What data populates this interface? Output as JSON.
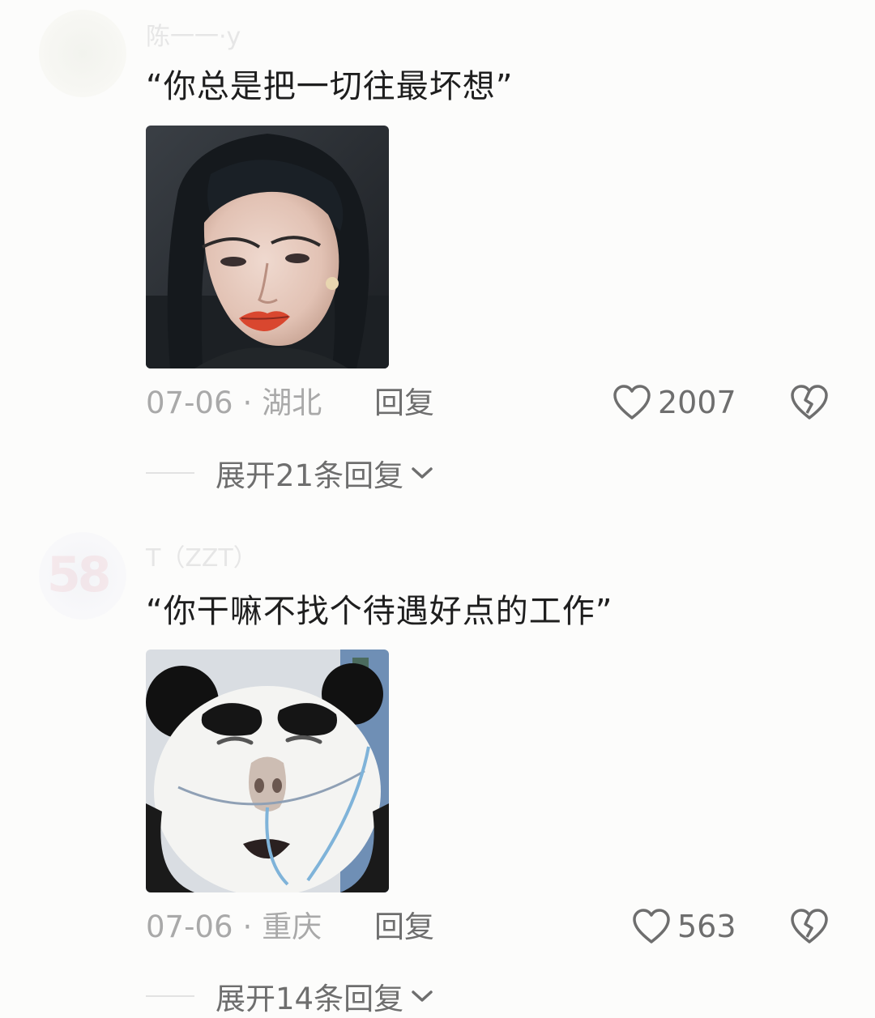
{
  "comments": [
    {
      "username": "陈一一·y",
      "text": "“你总是把一切往最坏想”",
      "image": "woman-with-red-lipstick-meme",
      "date": "07-06",
      "location": "湖北",
      "reply_label": "回复",
      "likes": "2007",
      "expand_label": "展开21条回复"
    },
    {
      "username": "T（ZZT）",
      "avatar_text": "58",
      "text": "“你干嘛不找个待遇好点的工作”",
      "image": "panda-face-hospital-meme",
      "date": "07-06",
      "location": "重庆",
      "reply_label": "回复",
      "likes": "563",
      "expand_label": "展开14条回复"
    }
  ],
  "separator": "·",
  "icons": {
    "like": "heart-outline-icon",
    "dislike": "broken-heart-icon",
    "expand": "chevron-down-icon"
  },
  "colors": {
    "background": "#fcfcfb",
    "text": "#1e1e1e",
    "muted": "#a9a9a9",
    "action": "#6e6e6e"
  }
}
